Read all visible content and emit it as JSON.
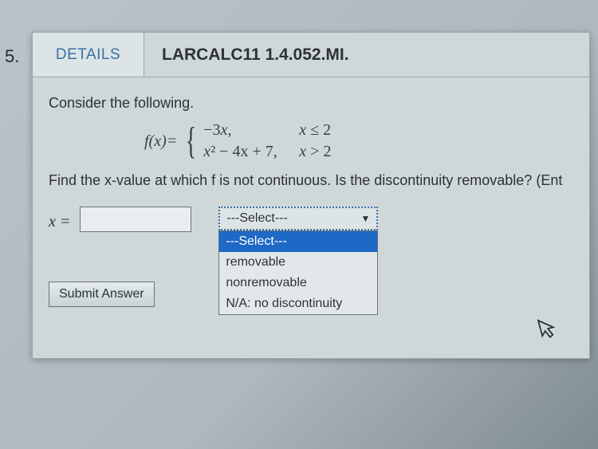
{
  "question_number": "5.",
  "header": {
    "details_label": "DETAILS",
    "source": "LARCALC11 1.4.052.MI."
  },
  "content": {
    "prompt1": "Consider the following.",
    "func_label": "f(x)=",
    "cases": [
      {
        "expr_pre": "−3",
        "var": "x",
        "expr_post": ",",
        "cond_var": "x",
        "cond_rest": " ≤ 2"
      },
      {
        "expr_pre": "",
        "var": "x",
        "expr_post": "² − 4x + 7,",
        "cond_var": "x",
        "cond_rest": " > 2"
      }
    ],
    "prompt2": "Find the x-value at which f is not continuous. Is the discontinuity removable? (Ent",
    "x_label": "x =",
    "select_placeholder": "---Select---",
    "dropdown_options": [
      "---Select---",
      "removable",
      "nonremovable",
      "N/A: no discontinuity"
    ],
    "submit_label": "Submit Answer"
  }
}
